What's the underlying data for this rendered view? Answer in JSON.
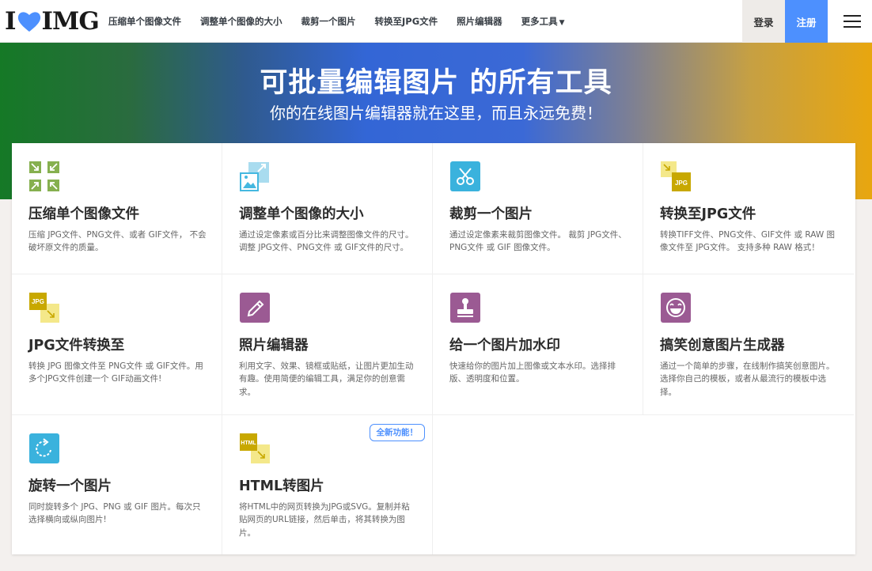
{
  "header": {
    "logo": {
      "left": "I",
      "right": "IMG"
    },
    "nav": [
      "压缩单个图像文件",
      "调整单个图像的大小",
      "裁剪一个图片",
      "转换至JPG文件",
      "照片编辑器",
      "更多工具"
    ],
    "login": "登录",
    "signup": "注册"
  },
  "hero": {
    "title": "可批量编辑图片 的所有工具",
    "subtitle": "你的在线图片编辑器就在这里，而且永远免费！"
  },
  "tools": [
    {
      "title": "压缩单个图像文件",
      "desc": "压缩 JPG文件、PNG文件、或者 GIF文件， 不会破坏原文件的质量。",
      "icon": "compress-icon"
    },
    {
      "title": "调整单个图像的大小",
      "desc": "通过设定像素或百分比来调整图像文件的尺寸。 调整 JPG文件、PNG文件 或 GIF文件的尺寸。",
      "icon": "resize-icon"
    },
    {
      "title": "裁剪一个图片",
      "desc": "通过设定像素来裁剪图像文件。 裁剪 JPG文件、PNG文件 或 GIF 图像文件。",
      "icon": "crop-icon"
    },
    {
      "title": "转换至JPG文件",
      "desc": "转换TIFF文件、PNG文件、GIF文件 或 RAW 图像文件至 JPG文件。 支持多种 RAW 格式！",
      "icon": "convert-to-jpg-icon",
      "icon_label": "JPG"
    },
    {
      "title": "JPG文件转换至",
      "desc": "转换 JPG 图像文件至 PNG文件 或 GIF文件。用多个JPG文件创建一个 GIF动画文件!",
      "icon": "convert-from-jpg-icon",
      "icon_label": "JPG"
    },
    {
      "title": "照片编辑器",
      "desc": "利用文字、效果、镜框或贴纸，让图片更加生动有趣。使用简便的编辑工具，满足你的创意需求。",
      "icon": "photo-editor-icon"
    },
    {
      "title": "给一个图片加水印",
      "desc": "快速给你的图片加上图像或文本水印。选择排版、透明度和位置。",
      "icon": "watermark-icon"
    },
    {
      "title": "搞笑创意图片生成器",
      "desc": "通过一个简单的步骤，在线制作搞笑创意图片。选择你自己的模板，或者从最流行的模板中选择。",
      "icon": "meme-generator-icon"
    },
    {
      "title": "旋转一个图片",
      "desc": "同时旋转多个 JPG、PNG 或 GIF 图片。每次只选择横向或纵向图片!",
      "icon": "rotate-icon"
    },
    {
      "title": "HTML转图片",
      "desc": "将HTML中的网页转换为JPG或SVG。复制并粘贴网页的URL链接，然后单击，将其转换为图片。",
      "icon": "html-to-image-icon",
      "icon_label": "HTML",
      "badge": "全新功能！"
    }
  ],
  "colors": {
    "brand_blue": "#4d90fe",
    "compress": "#86b04f",
    "resize": "#45b8e0",
    "crop": "#3ab2dd",
    "jpg": "#c8a800",
    "jpg_light": "#f4e88a",
    "editor": "#9b5a93",
    "watermark": "#9b5a93",
    "meme": "#9b5a93",
    "rotate": "#3ab2dd",
    "html": "#c8a800"
  }
}
